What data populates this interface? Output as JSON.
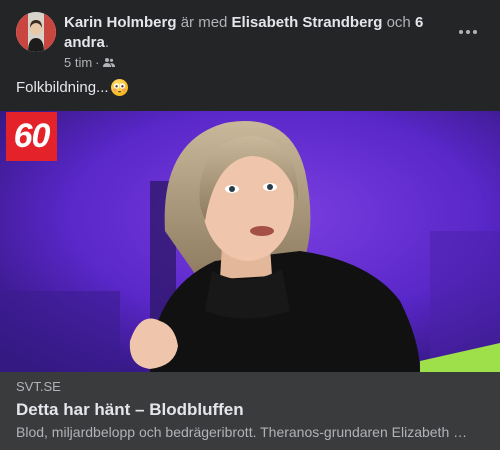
{
  "post": {
    "author": "Karin Holmberg",
    "with_text": "är med",
    "tagged": "Elisabeth Strandberg",
    "and_text": "och",
    "others": "6 andra",
    "period": ".",
    "time": "5 tim",
    "dot": "·",
    "privacy_icon": "friends-icon",
    "text": "Folkbildning...",
    "emoji": "flushed-face-emoji"
  },
  "link": {
    "badge": "60",
    "domain": "SVT.SE",
    "title": "Detta har hänt – Blodbluffen",
    "description": "Blod, miljardbelopp och bedrägeribrott. Theranos-grundaren Elizabeth Holmes"
  },
  "colors": {
    "background": "#242526",
    "link_box": "#3a3b3c",
    "badge": "#e4222a"
  }
}
